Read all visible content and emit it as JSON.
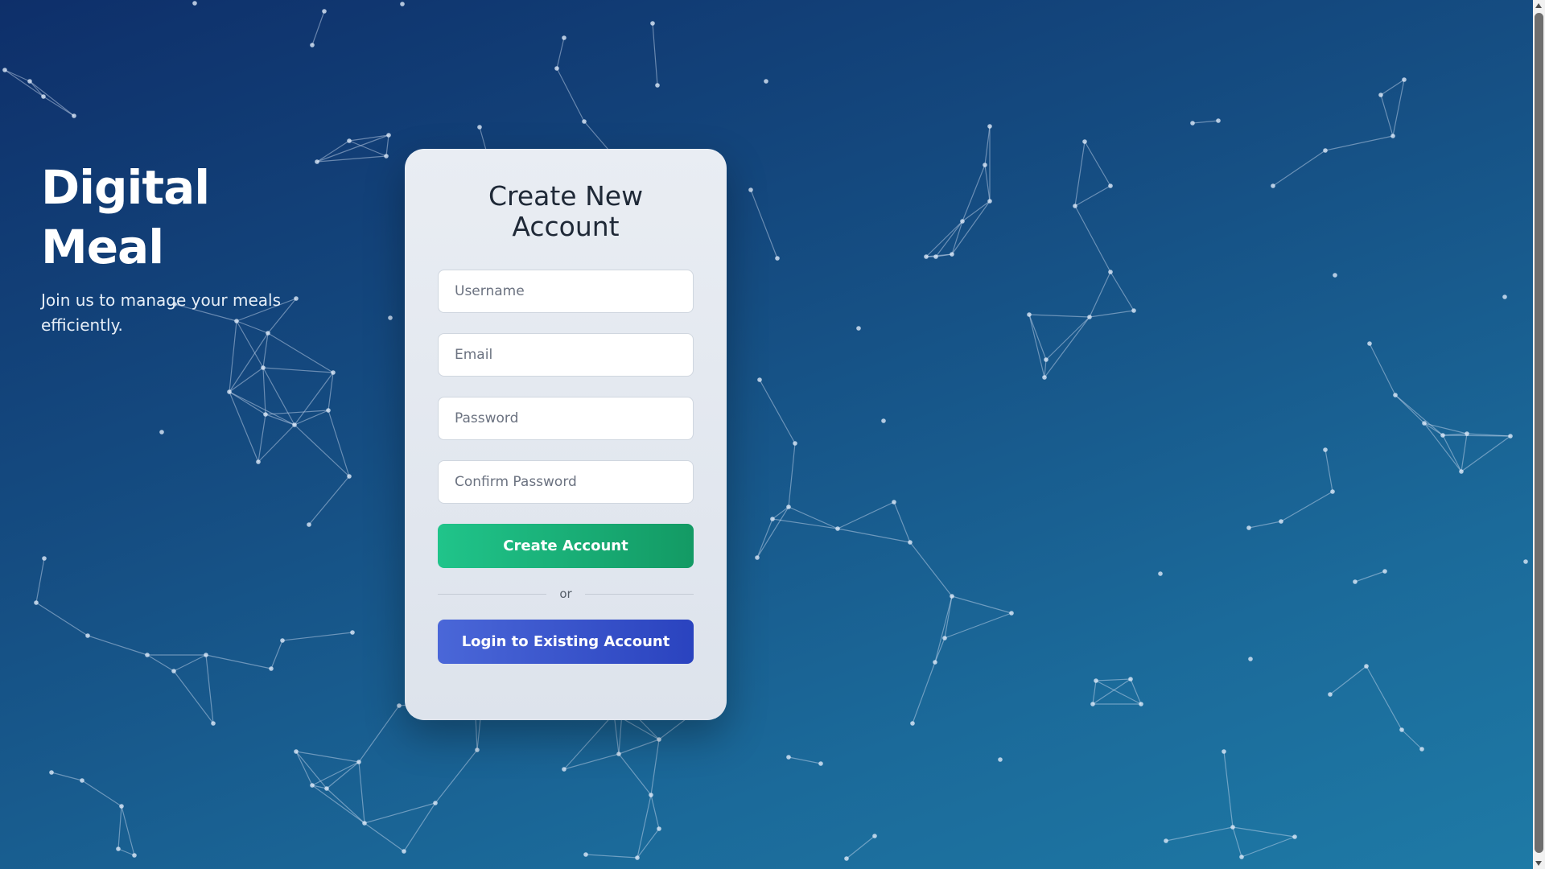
{
  "brand": {
    "title": "Digital Meal",
    "tagline": "Join us to manage your meals efficiently."
  },
  "register_form": {
    "title": "Create New Account",
    "username_placeholder": "Username",
    "email_placeholder": "Email",
    "password_placeholder": "Password",
    "confirm_password_placeholder": "Confirm Password",
    "create_button_label": "Create Account",
    "divider_text": "or",
    "login_button_label": "Login to Existing Account"
  },
  "theme": {
    "background_start": "#0e2f6a",
    "background_end": "#1e7aa6",
    "create_button_color": "#1aae76",
    "login_button_color": "#3a55cc",
    "card_color": "#e4e9f0"
  }
}
